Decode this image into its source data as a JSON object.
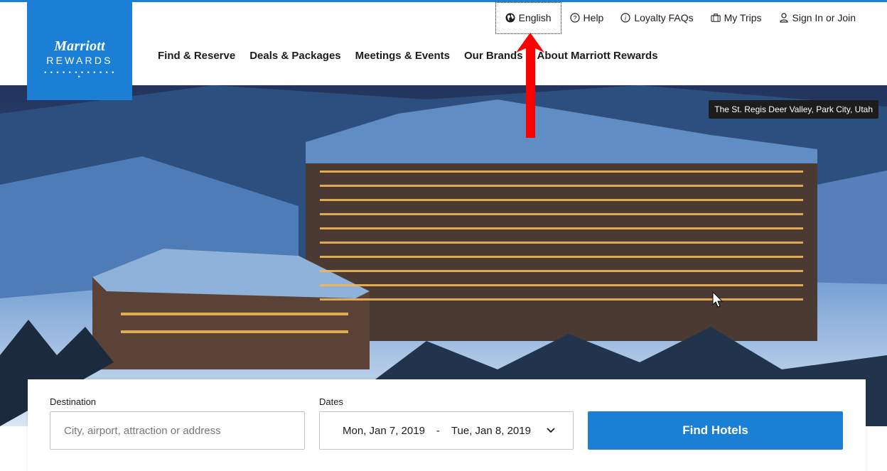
{
  "logo": {
    "brand": "Marriott",
    "sub": "REWARDS",
    "dots": "• • • • • • • • • • • • •"
  },
  "utility": {
    "language": "English",
    "help": "Help",
    "loyalty": "Loyalty FAQs",
    "trips": "My Trips",
    "signin": "Sign In or Join"
  },
  "nav": {
    "find": "Find & Reserve",
    "deals": "Deals & Packages",
    "meetings": "Meetings & Events",
    "brands": "Our Brands",
    "about": "About Marriott Rewards"
  },
  "hero": {
    "caption": "The St. Regis Deer Valley, Park City, Utah"
  },
  "search": {
    "destination_label": "Destination",
    "destination_placeholder": "City, airport, attraction or address",
    "dates_label": "Dates",
    "check_in": "Mon, Jan 7, 2019",
    "separator": "-",
    "check_out": "Tue, Jan 8, 2019",
    "submit": "Find Hotels"
  },
  "colors": {
    "brand_blue": "#1c7fd6",
    "annotation_red": "#ff0000"
  }
}
